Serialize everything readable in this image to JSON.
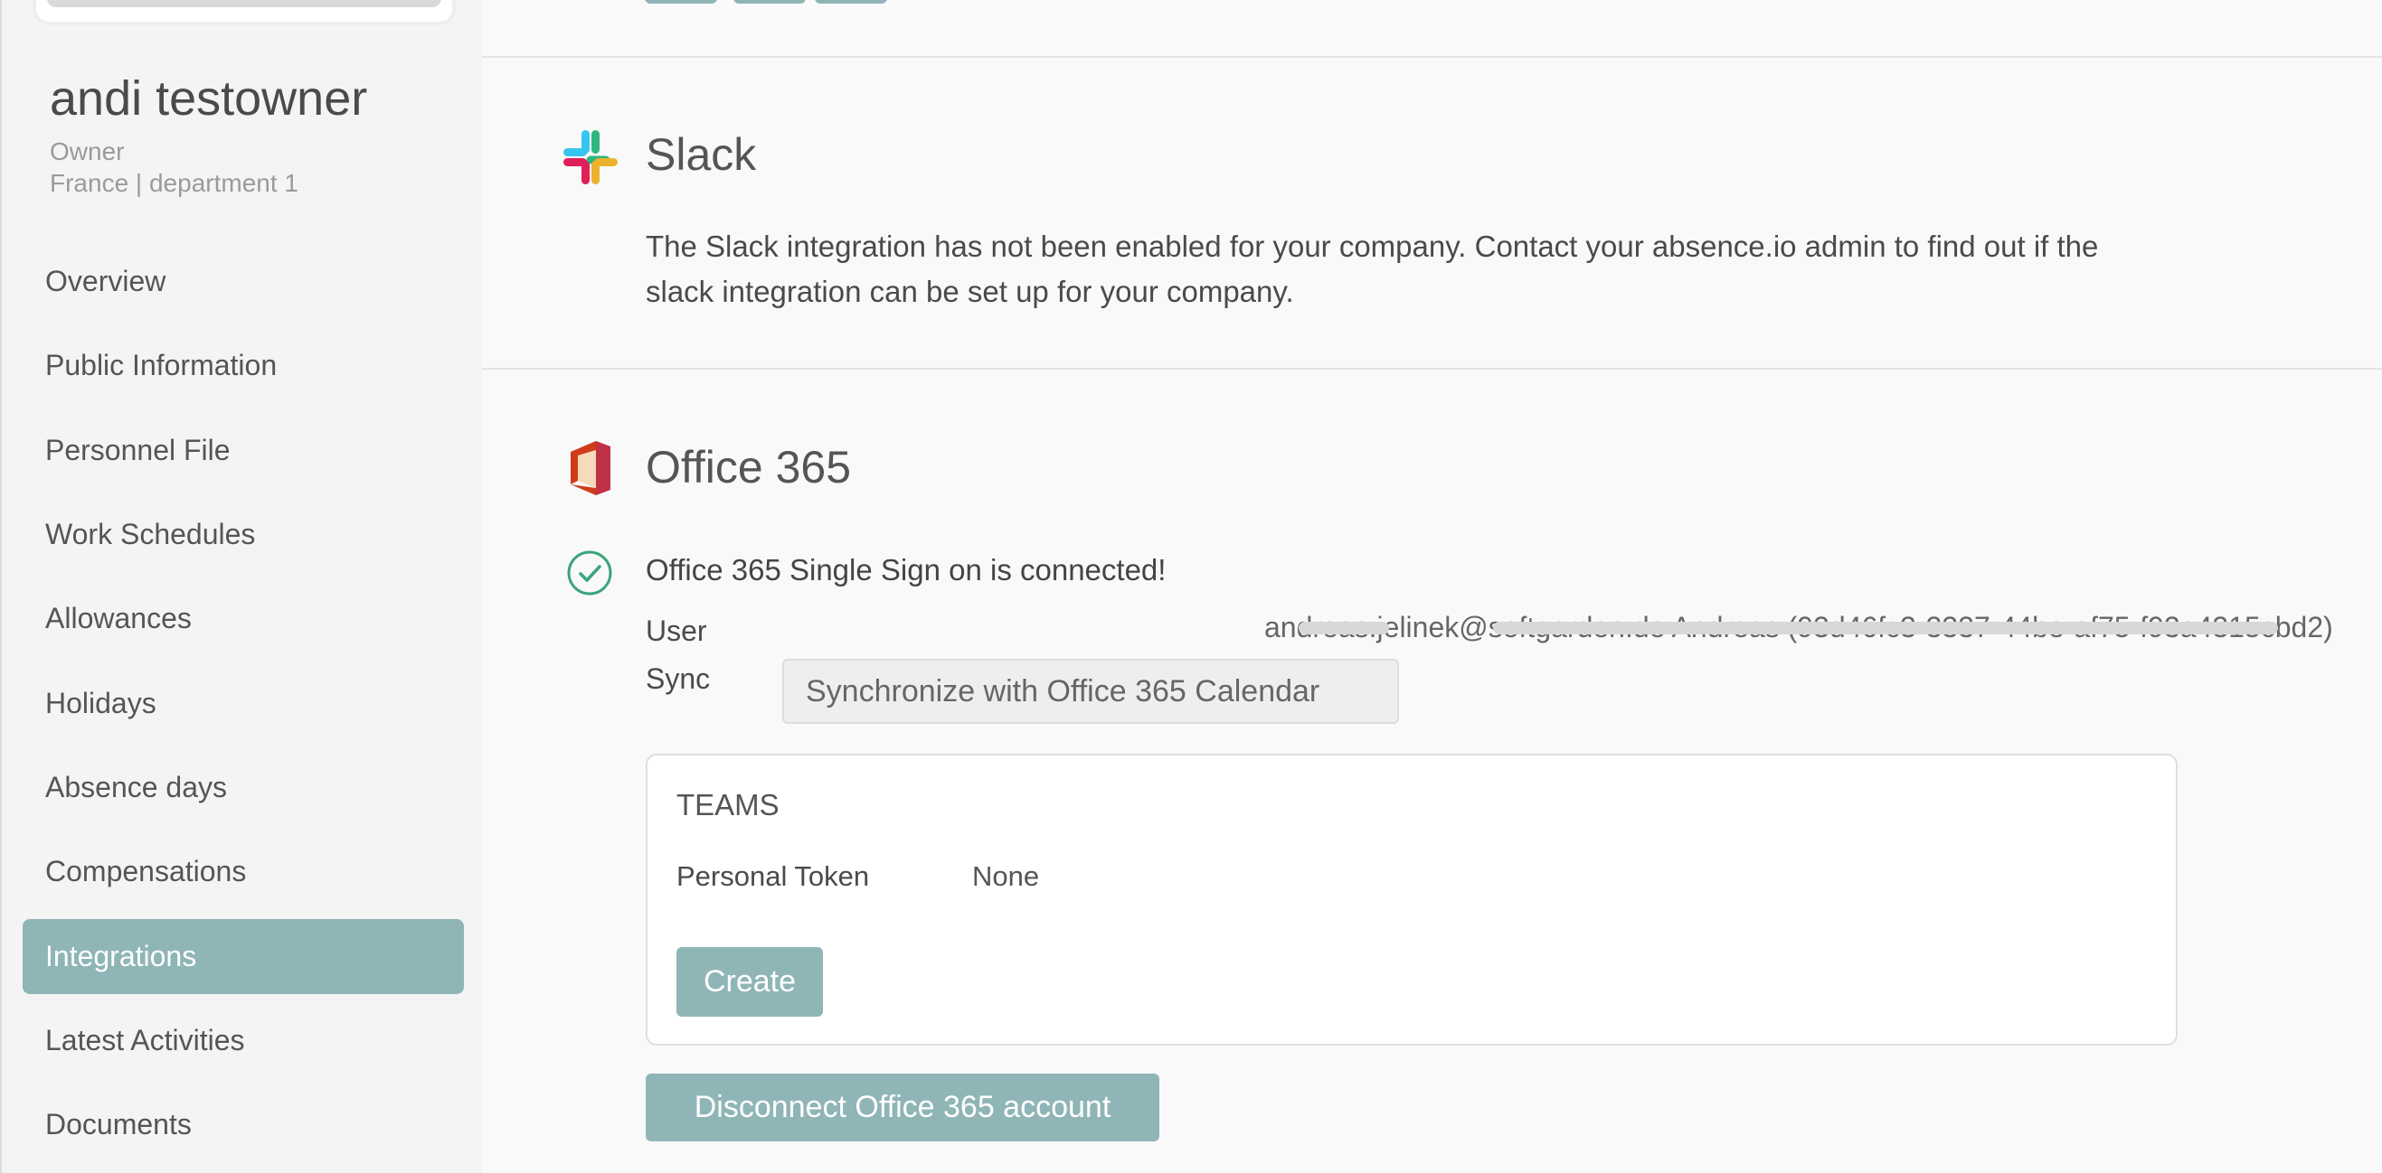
{
  "profile": {
    "name": "andi testowner",
    "role": "Owner",
    "location": "France | department 1"
  },
  "sidebar": {
    "items": [
      {
        "label": "Overview",
        "active": false
      },
      {
        "label": "Public Information",
        "active": false
      },
      {
        "label": "Personnel File",
        "active": false
      },
      {
        "label": "Work Schedules",
        "active": false
      },
      {
        "label": "Allowances",
        "active": false
      },
      {
        "label": "Holidays",
        "active": false
      },
      {
        "label": "Absence days",
        "active": false
      },
      {
        "label": "Compensations",
        "active": false
      },
      {
        "label": "Integrations",
        "active": true
      },
      {
        "label": "Latest Activities",
        "active": false
      },
      {
        "label": "Documents",
        "active": false
      }
    ]
  },
  "slack": {
    "title": "Slack",
    "icon": "slack-icon",
    "message_line1": "The Slack integration has not been enabled for your company. Contact your absence.io admin to find out if the",
    "message_line2": "slack integration can be set up for your company."
  },
  "office365": {
    "title": "Office 365",
    "icon": "office365-icon",
    "status_icon": "check-circle-icon",
    "status_text": "Office 365 Single Sign on is connected!",
    "user_label": "User",
    "user_value": "andreas.jelinek@softgarden.de Andreas (93d46fc3-3337-44be-af75-f93a4315cbd2)",
    "sync_label": "Sync",
    "sync_button": "Synchronize with Office 365 Calendar",
    "teams": {
      "title": "TEAMS",
      "token_label": "Personal Token",
      "token_value": "None",
      "create_button": "Create"
    },
    "disconnect_button": "Disconnect Office 365 account"
  },
  "colors": {
    "accent": "#8fb5b7",
    "check_green": "#3aa57a",
    "office_red": "#d13b1a"
  }
}
